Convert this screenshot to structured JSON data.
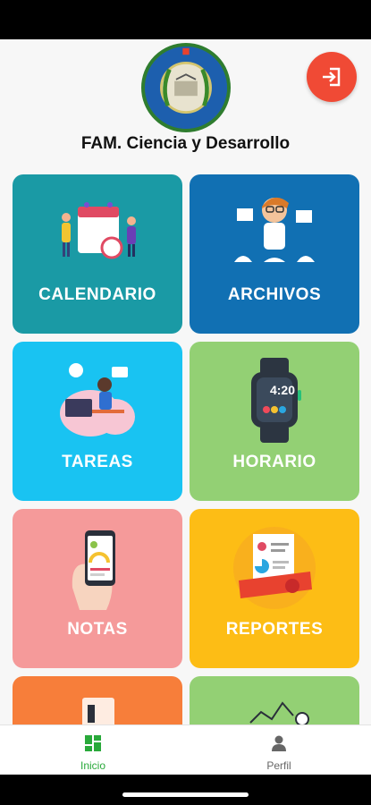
{
  "header": {
    "title": "FAM. Ciencia y Desarrollo"
  },
  "tiles": [
    {
      "label": "CALENDARIO",
      "color": "#1a9aa5",
      "icon": "calendar-people-illustration"
    },
    {
      "label": "ARCHIVOS",
      "color": "#1170b3",
      "icon": "files-person-illustration"
    },
    {
      "label": "TAREAS",
      "color": "#19c3f2",
      "icon": "homework-illustration"
    },
    {
      "label": "HORARIO",
      "color": "#93d074",
      "icon": "smartwatch-illustration",
      "watch_time": "4:20"
    },
    {
      "label": "NOTAS",
      "color": "#f59a9a",
      "icon": "phone-grades-illustration"
    },
    {
      "label": "REPORTES",
      "color": "#fdbd15",
      "icon": "report-document-illustration"
    }
  ],
  "nav": {
    "items": [
      {
        "label": "Inicio",
        "active": true,
        "color": "#29a93a"
      },
      {
        "label": "Perfil",
        "active": false,
        "color": "#666666"
      }
    ]
  }
}
